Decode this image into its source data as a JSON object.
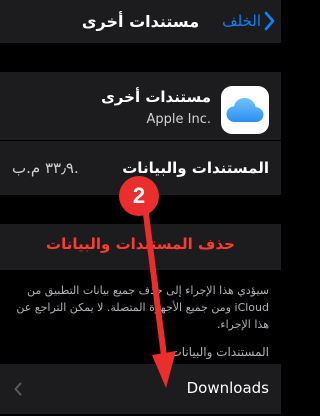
{
  "nav": {
    "back_label": "الخلف",
    "title": "مستندات أخرى"
  },
  "app": {
    "name": "مستندات أخرى",
    "vendor": "Apple Inc."
  },
  "docs": {
    "label": "المستندات والبيانات",
    "size": "٣٣٫٩ م.ب."
  },
  "delete": {
    "label": "حذف المستندات والبيانات"
  },
  "footer_note": "سيؤدي هذا الإجراء إلى حذف جميع بيانات التطبيق من iCloud ومن جميع الأجهزة المتصلة. لا يمكن التراجع عن هذا الإجراء.",
  "section_header": "المستندات والبيانات",
  "downloads": {
    "label": "Downloads"
  },
  "annotation": {
    "step_number": "2"
  },
  "colors": {
    "accent": "#0a84ff",
    "destructive": "#ff3b30",
    "annotation": "#ea2d2d",
    "cell_background": "#1c1c1e"
  },
  "icons": [
    "chevron-right-icon",
    "icloud-icon",
    "chevron-left-icon",
    "arrow-down-icon"
  ]
}
